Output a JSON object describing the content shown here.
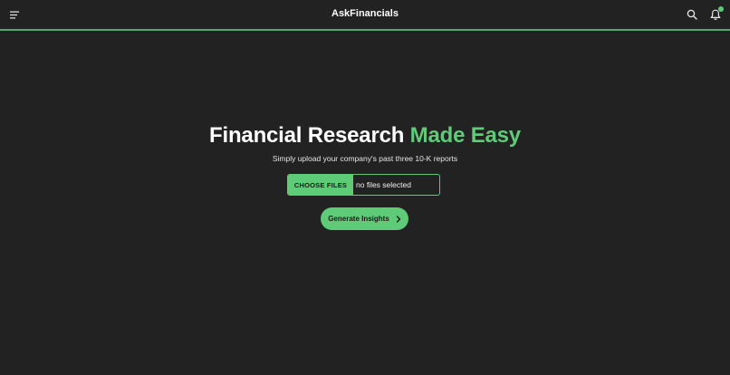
{
  "header": {
    "title": "AskFinancials",
    "icons": {
      "menu": "menu-icon",
      "search": "search-icon",
      "notifications": "bell-icon"
    },
    "has_notification": true
  },
  "hero": {
    "title_main": "Financial Research",
    "title_accent": "Made Easy",
    "subtitle": "Simply upload your company's past three 10-K reports"
  },
  "upload": {
    "choose_label": "CHOOSE FILES",
    "status_text": "no files selected"
  },
  "actions": {
    "generate_label": "Generate Insights",
    "generate_icon": "chevron-right-icon"
  },
  "colors": {
    "background": "#222222",
    "accent": "#5ecb78",
    "accent_bar": "#4caf68",
    "text": "#ffffff"
  }
}
